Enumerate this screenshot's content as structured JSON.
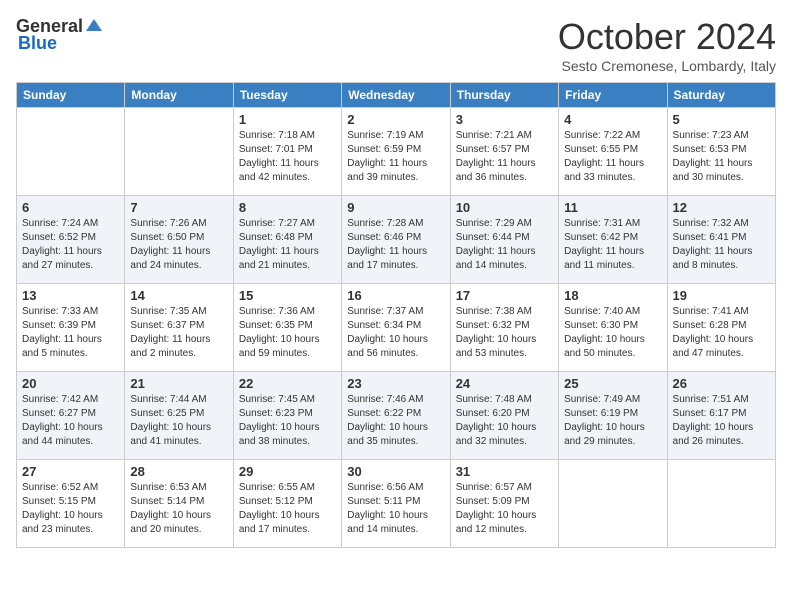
{
  "header": {
    "logo_general": "General",
    "logo_blue": "Blue",
    "month_title": "October 2024",
    "subtitle": "Sesto Cremonese, Lombardy, Italy"
  },
  "days_of_week": [
    "Sunday",
    "Monday",
    "Tuesday",
    "Wednesday",
    "Thursday",
    "Friday",
    "Saturday"
  ],
  "weeks": [
    [
      {
        "day": "",
        "info": ""
      },
      {
        "day": "",
        "info": ""
      },
      {
        "day": "1",
        "info": "Sunrise: 7:18 AM\nSunset: 7:01 PM\nDaylight: 11 hours and 42 minutes."
      },
      {
        "day": "2",
        "info": "Sunrise: 7:19 AM\nSunset: 6:59 PM\nDaylight: 11 hours and 39 minutes."
      },
      {
        "day": "3",
        "info": "Sunrise: 7:21 AM\nSunset: 6:57 PM\nDaylight: 11 hours and 36 minutes."
      },
      {
        "day": "4",
        "info": "Sunrise: 7:22 AM\nSunset: 6:55 PM\nDaylight: 11 hours and 33 minutes."
      },
      {
        "day": "5",
        "info": "Sunrise: 7:23 AM\nSunset: 6:53 PM\nDaylight: 11 hours and 30 minutes."
      }
    ],
    [
      {
        "day": "6",
        "info": "Sunrise: 7:24 AM\nSunset: 6:52 PM\nDaylight: 11 hours and 27 minutes."
      },
      {
        "day": "7",
        "info": "Sunrise: 7:26 AM\nSunset: 6:50 PM\nDaylight: 11 hours and 24 minutes."
      },
      {
        "day": "8",
        "info": "Sunrise: 7:27 AM\nSunset: 6:48 PM\nDaylight: 11 hours and 21 minutes."
      },
      {
        "day": "9",
        "info": "Sunrise: 7:28 AM\nSunset: 6:46 PM\nDaylight: 11 hours and 17 minutes."
      },
      {
        "day": "10",
        "info": "Sunrise: 7:29 AM\nSunset: 6:44 PM\nDaylight: 11 hours and 14 minutes."
      },
      {
        "day": "11",
        "info": "Sunrise: 7:31 AM\nSunset: 6:42 PM\nDaylight: 11 hours and 11 minutes."
      },
      {
        "day": "12",
        "info": "Sunrise: 7:32 AM\nSunset: 6:41 PM\nDaylight: 11 hours and 8 minutes."
      }
    ],
    [
      {
        "day": "13",
        "info": "Sunrise: 7:33 AM\nSunset: 6:39 PM\nDaylight: 11 hours and 5 minutes."
      },
      {
        "day": "14",
        "info": "Sunrise: 7:35 AM\nSunset: 6:37 PM\nDaylight: 11 hours and 2 minutes."
      },
      {
        "day": "15",
        "info": "Sunrise: 7:36 AM\nSunset: 6:35 PM\nDaylight: 10 hours and 59 minutes."
      },
      {
        "day": "16",
        "info": "Sunrise: 7:37 AM\nSunset: 6:34 PM\nDaylight: 10 hours and 56 minutes."
      },
      {
        "day": "17",
        "info": "Sunrise: 7:38 AM\nSunset: 6:32 PM\nDaylight: 10 hours and 53 minutes."
      },
      {
        "day": "18",
        "info": "Sunrise: 7:40 AM\nSunset: 6:30 PM\nDaylight: 10 hours and 50 minutes."
      },
      {
        "day": "19",
        "info": "Sunrise: 7:41 AM\nSunset: 6:28 PM\nDaylight: 10 hours and 47 minutes."
      }
    ],
    [
      {
        "day": "20",
        "info": "Sunrise: 7:42 AM\nSunset: 6:27 PM\nDaylight: 10 hours and 44 minutes."
      },
      {
        "day": "21",
        "info": "Sunrise: 7:44 AM\nSunset: 6:25 PM\nDaylight: 10 hours and 41 minutes."
      },
      {
        "day": "22",
        "info": "Sunrise: 7:45 AM\nSunset: 6:23 PM\nDaylight: 10 hours and 38 minutes."
      },
      {
        "day": "23",
        "info": "Sunrise: 7:46 AM\nSunset: 6:22 PM\nDaylight: 10 hours and 35 minutes."
      },
      {
        "day": "24",
        "info": "Sunrise: 7:48 AM\nSunset: 6:20 PM\nDaylight: 10 hours and 32 minutes."
      },
      {
        "day": "25",
        "info": "Sunrise: 7:49 AM\nSunset: 6:19 PM\nDaylight: 10 hours and 29 minutes."
      },
      {
        "day": "26",
        "info": "Sunrise: 7:51 AM\nSunset: 6:17 PM\nDaylight: 10 hours and 26 minutes."
      }
    ],
    [
      {
        "day": "27",
        "info": "Sunrise: 6:52 AM\nSunset: 5:15 PM\nDaylight: 10 hours and 23 minutes."
      },
      {
        "day": "28",
        "info": "Sunrise: 6:53 AM\nSunset: 5:14 PM\nDaylight: 10 hours and 20 minutes."
      },
      {
        "day": "29",
        "info": "Sunrise: 6:55 AM\nSunset: 5:12 PM\nDaylight: 10 hours and 17 minutes."
      },
      {
        "day": "30",
        "info": "Sunrise: 6:56 AM\nSunset: 5:11 PM\nDaylight: 10 hours and 14 minutes."
      },
      {
        "day": "31",
        "info": "Sunrise: 6:57 AM\nSunset: 5:09 PM\nDaylight: 10 hours and 12 minutes."
      },
      {
        "day": "",
        "info": ""
      },
      {
        "day": "",
        "info": ""
      }
    ]
  ]
}
